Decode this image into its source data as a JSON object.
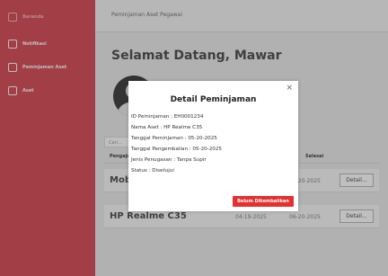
{
  "sidebar": {
    "items": [
      {
        "label": "Beranda",
        "icon": "home-icon"
      },
      {
        "label": "Notifikasi",
        "icon": "bell-icon"
      },
      {
        "label": "Peminjaman Aset",
        "icon": "borrow-icon"
      },
      {
        "label": "Aset",
        "icon": "asset-icon"
      }
    ]
  },
  "topbar": {
    "title": "Peminjaman Aset Pegawai"
  },
  "welcome": "Selamat Datang, Mawar",
  "search": {
    "placeholder": "Cari..."
  },
  "table": {
    "headers": {
      "pengajuan": "Pengajuan",
      "selesai": "Selesai"
    },
    "rows": [
      {
        "name": "Mobil Innova",
        "start": "",
        "end": "05-20-2025",
        "action": "Detail..."
      },
      {
        "name": "HP Realme C35",
        "start": "04-19-2025",
        "end": "06-20-2025",
        "action": "Detail..."
      }
    ]
  },
  "modal": {
    "close": "×",
    "title": "Detail Peminjaman",
    "lines": [
      "ID Peminjaman : EH0001234",
      "Nama Aset : HP Realme C35",
      "Tanggal Peminjaman : 05-20-2025",
      "Tanggal Pengembalian : 05-20-2025",
      "Jenis Penugasan : Tanpa Supir",
      "Status : Disetujui"
    ],
    "button": "Belum Dikembalikan"
  },
  "colors": {
    "sidebar": "#d9535d",
    "accent_button": "#e53030"
  }
}
